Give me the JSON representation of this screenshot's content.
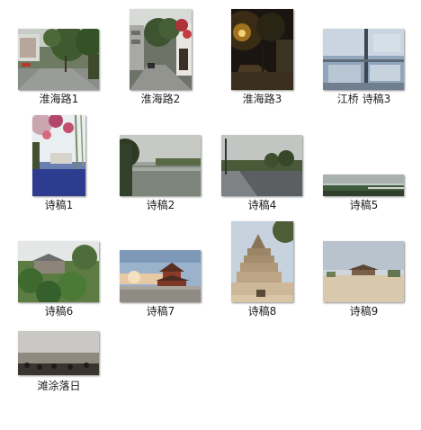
{
  "items": [
    {
      "label": "淮海路1"
    },
    {
      "label": "淮海路2"
    },
    {
      "label": "淮海路3"
    },
    {
      "label": "江桥 诗稿3"
    },
    {
      "label": "诗稿1"
    },
    {
      "label": "诗稿2"
    },
    {
      "label": "诗稿4"
    },
    {
      "label": "诗稿5"
    },
    {
      "label": "诗稿6"
    },
    {
      "label": "诗稿7"
    },
    {
      "label": "诗稿8"
    },
    {
      "label": "诗稿9"
    },
    {
      "label": "滩涂落日"
    }
  ]
}
